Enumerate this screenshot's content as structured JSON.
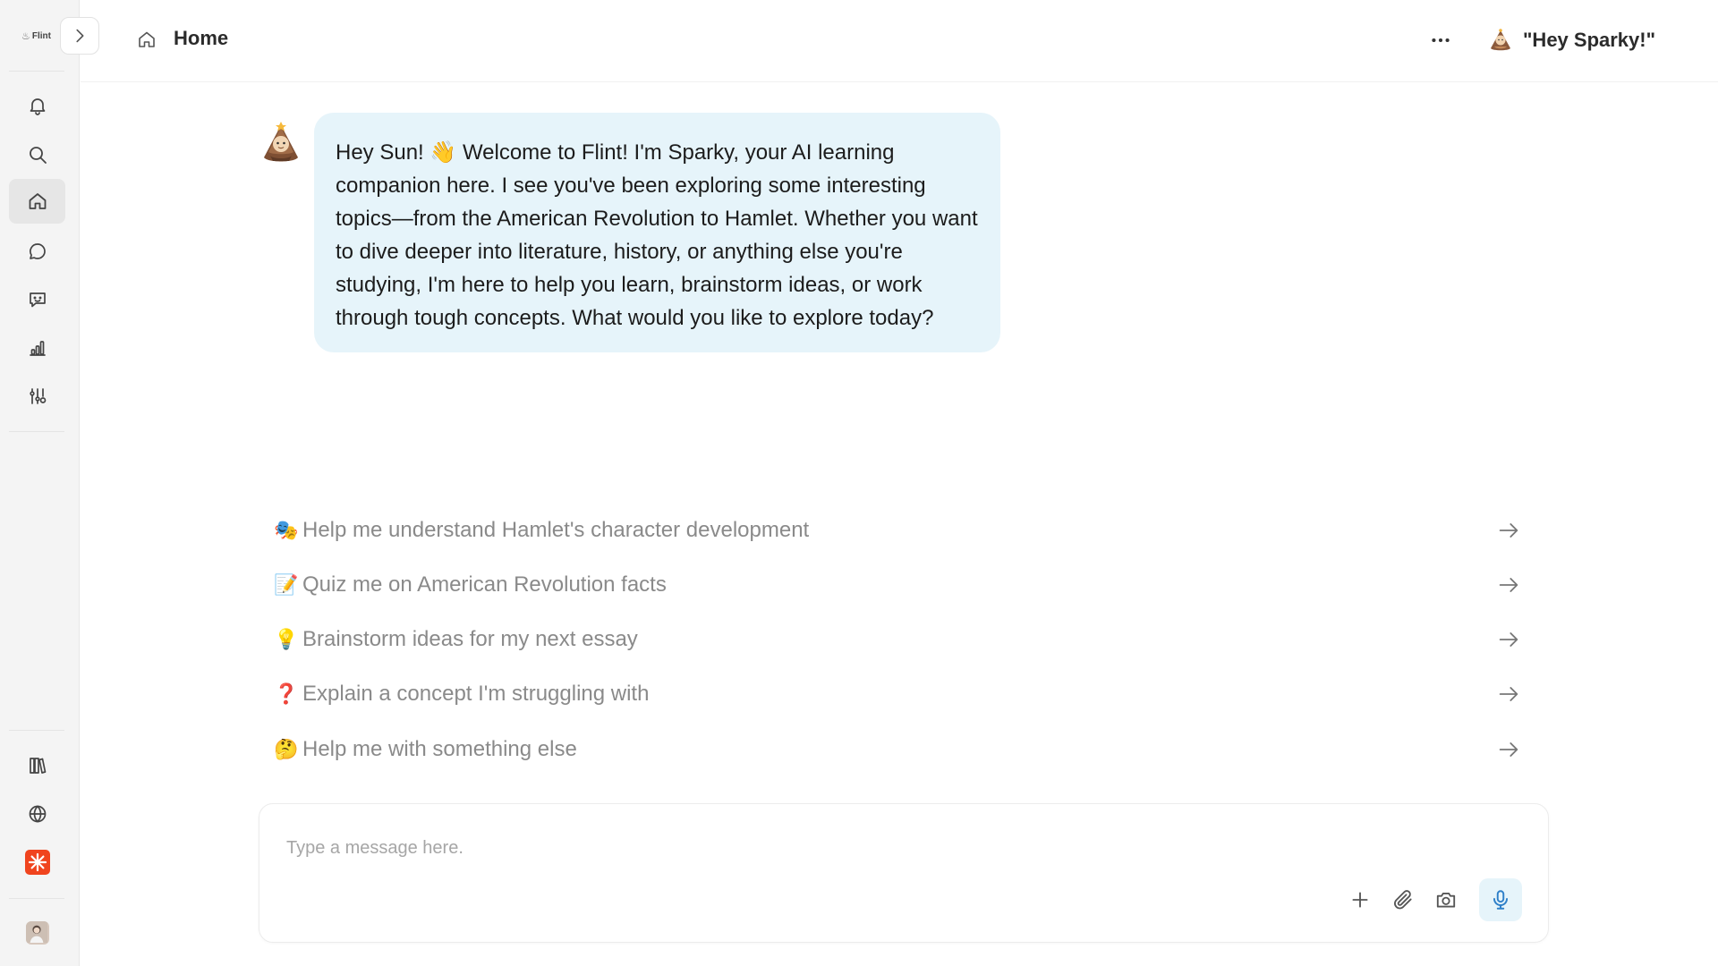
{
  "sidebar": {
    "logo_text": "Flint",
    "items": [
      {
        "name": "notifications",
        "icon": "bell-icon"
      },
      {
        "name": "search",
        "icon": "search-icon"
      },
      {
        "name": "home",
        "icon": "home-icon",
        "active": true
      },
      {
        "name": "chat",
        "icon": "chat-bubble-icon"
      },
      {
        "name": "feedback",
        "icon": "message-square-icon"
      },
      {
        "name": "analytics",
        "icon": "bar-chart-icon"
      },
      {
        "name": "settings",
        "icon": "sliders-icon"
      },
      {
        "name": "library",
        "icon": "books-icon"
      },
      {
        "name": "language",
        "icon": "globe-icon"
      },
      {
        "name": "brand",
        "icon": "asterisk-icon"
      },
      {
        "name": "profile",
        "icon": "user-avatar"
      }
    ]
  },
  "header": {
    "title": "Home",
    "assistant_label": "\"Hey Sparky!\""
  },
  "chat": {
    "message": "Hey Sun! 👋 Welcome to Flint! I'm Sparky, your AI learning companion here. I see you've been exploring some interesting topics—from the American Revolution to Hamlet. Whether you want to dive deeper into literature, history, or anything else you're studying, I'm here to help you learn, brainstorm ideas, or work through tough concepts. What would you like to explore today?"
  },
  "suggestions": [
    {
      "emoji": "🎭",
      "text": "Help me understand Hamlet's character development"
    },
    {
      "emoji": "📝",
      "text": "Quiz me on American Revolution facts"
    },
    {
      "emoji": "💡",
      "text": "Brainstorm ideas for my next essay"
    },
    {
      "emoji": "❓",
      "text": "Explain a concept I'm struggling with"
    },
    {
      "emoji": "🤔",
      "text": "Help me with something else"
    }
  ],
  "composer": {
    "placeholder": "Type a message here.",
    "value": ""
  },
  "colors": {
    "accent_blue": "#2f80c9",
    "bubble_bg": "#e6f4fa",
    "brand_orange": "#f0441e"
  }
}
